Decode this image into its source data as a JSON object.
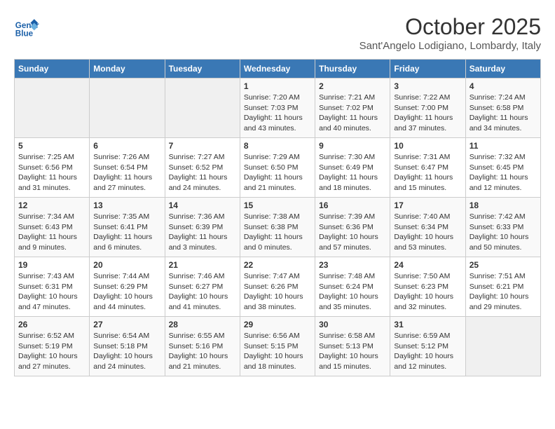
{
  "header": {
    "logo_line1": "General",
    "logo_line2": "Blue",
    "month": "October 2025",
    "location": "Sant'Angelo Lodigiano, Lombardy, Italy"
  },
  "days_of_week": [
    "Sunday",
    "Monday",
    "Tuesday",
    "Wednesday",
    "Thursday",
    "Friday",
    "Saturday"
  ],
  "weeks": [
    [
      {
        "day": "",
        "info": ""
      },
      {
        "day": "",
        "info": ""
      },
      {
        "day": "",
        "info": ""
      },
      {
        "day": "1",
        "info": "Sunrise: 7:20 AM\nSunset: 7:03 PM\nDaylight: 11 hours and 43 minutes."
      },
      {
        "day": "2",
        "info": "Sunrise: 7:21 AM\nSunset: 7:02 PM\nDaylight: 11 hours and 40 minutes."
      },
      {
        "day": "3",
        "info": "Sunrise: 7:22 AM\nSunset: 7:00 PM\nDaylight: 11 hours and 37 minutes."
      },
      {
        "day": "4",
        "info": "Sunrise: 7:24 AM\nSunset: 6:58 PM\nDaylight: 11 hours and 34 minutes."
      }
    ],
    [
      {
        "day": "5",
        "info": "Sunrise: 7:25 AM\nSunset: 6:56 PM\nDaylight: 11 hours and 31 minutes."
      },
      {
        "day": "6",
        "info": "Sunrise: 7:26 AM\nSunset: 6:54 PM\nDaylight: 11 hours and 27 minutes."
      },
      {
        "day": "7",
        "info": "Sunrise: 7:27 AM\nSunset: 6:52 PM\nDaylight: 11 hours and 24 minutes."
      },
      {
        "day": "8",
        "info": "Sunrise: 7:29 AM\nSunset: 6:50 PM\nDaylight: 11 hours and 21 minutes."
      },
      {
        "day": "9",
        "info": "Sunrise: 7:30 AM\nSunset: 6:49 PM\nDaylight: 11 hours and 18 minutes."
      },
      {
        "day": "10",
        "info": "Sunrise: 7:31 AM\nSunset: 6:47 PM\nDaylight: 11 hours and 15 minutes."
      },
      {
        "day": "11",
        "info": "Sunrise: 7:32 AM\nSunset: 6:45 PM\nDaylight: 11 hours and 12 minutes."
      }
    ],
    [
      {
        "day": "12",
        "info": "Sunrise: 7:34 AM\nSunset: 6:43 PM\nDaylight: 11 hours and 9 minutes."
      },
      {
        "day": "13",
        "info": "Sunrise: 7:35 AM\nSunset: 6:41 PM\nDaylight: 11 hours and 6 minutes."
      },
      {
        "day": "14",
        "info": "Sunrise: 7:36 AM\nSunset: 6:39 PM\nDaylight: 11 hours and 3 minutes."
      },
      {
        "day": "15",
        "info": "Sunrise: 7:38 AM\nSunset: 6:38 PM\nDaylight: 11 hours and 0 minutes."
      },
      {
        "day": "16",
        "info": "Sunrise: 7:39 AM\nSunset: 6:36 PM\nDaylight: 10 hours and 57 minutes."
      },
      {
        "day": "17",
        "info": "Sunrise: 7:40 AM\nSunset: 6:34 PM\nDaylight: 10 hours and 53 minutes."
      },
      {
        "day": "18",
        "info": "Sunrise: 7:42 AM\nSunset: 6:33 PM\nDaylight: 10 hours and 50 minutes."
      }
    ],
    [
      {
        "day": "19",
        "info": "Sunrise: 7:43 AM\nSunset: 6:31 PM\nDaylight: 10 hours and 47 minutes."
      },
      {
        "day": "20",
        "info": "Sunrise: 7:44 AM\nSunset: 6:29 PM\nDaylight: 10 hours and 44 minutes."
      },
      {
        "day": "21",
        "info": "Sunrise: 7:46 AM\nSunset: 6:27 PM\nDaylight: 10 hours and 41 minutes."
      },
      {
        "day": "22",
        "info": "Sunrise: 7:47 AM\nSunset: 6:26 PM\nDaylight: 10 hours and 38 minutes."
      },
      {
        "day": "23",
        "info": "Sunrise: 7:48 AM\nSunset: 6:24 PM\nDaylight: 10 hours and 35 minutes."
      },
      {
        "day": "24",
        "info": "Sunrise: 7:50 AM\nSunset: 6:23 PM\nDaylight: 10 hours and 32 minutes."
      },
      {
        "day": "25",
        "info": "Sunrise: 7:51 AM\nSunset: 6:21 PM\nDaylight: 10 hours and 29 minutes."
      }
    ],
    [
      {
        "day": "26",
        "info": "Sunrise: 6:52 AM\nSunset: 5:19 PM\nDaylight: 10 hours and 27 minutes."
      },
      {
        "day": "27",
        "info": "Sunrise: 6:54 AM\nSunset: 5:18 PM\nDaylight: 10 hours and 24 minutes."
      },
      {
        "day": "28",
        "info": "Sunrise: 6:55 AM\nSunset: 5:16 PM\nDaylight: 10 hours and 21 minutes."
      },
      {
        "day": "29",
        "info": "Sunrise: 6:56 AM\nSunset: 5:15 PM\nDaylight: 10 hours and 18 minutes."
      },
      {
        "day": "30",
        "info": "Sunrise: 6:58 AM\nSunset: 5:13 PM\nDaylight: 10 hours and 15 minutes."
      },
      {
        "day": "31",
        "info": "Sunrise: 6:59 AM\nSunset: 5:12 PM\nDaylight: 10 hours and 12 minutes."
      },
      {
        "day": "",
        "info": ""
      }
    ]
  ]
}
